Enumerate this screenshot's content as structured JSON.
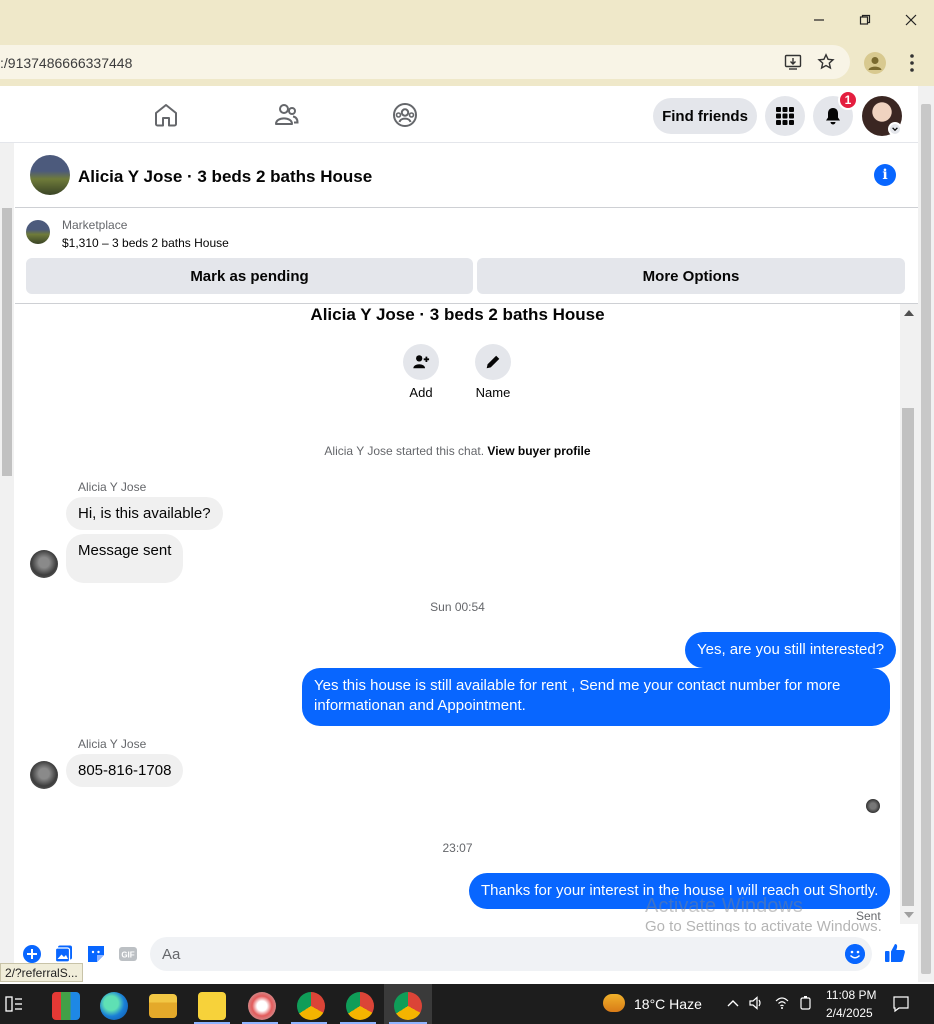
{
  "browser": {
    "url": ":/9137486666337448",
    "status_link": "2/?referralS..."
  },
  "nav": {
    "find_friends": "Find friends",
    "notification_count": "1"
  },
  "chat": {
    "title": "Alicia Y Jose · 3 beds 2 baths House",
    "marketplace_label": "Marketplace",
    "listing": "$1,310 – 3 beds 2 baths House",
    "mark_pending": "Mark as pending",
    "more_options": "More Options",
    "conversation_title": "Alicia Y Jose · 3 beds 2 baths House",
    "actions": [
      {
        "label": "Add",
        "icon": "add-person-icon"
      },
      {
        "label": "Name",
        "icon": "pencil-icon"
      }
    ],
    "system_message": "Alicia Y Jose started this chat.",
    "view_buyer_profile": "View buyer profile"
  },
  "messages": {
    "sender1": "Alicia Y Jose",
    "in1": "Hi, is this available?",
    "in2": "Message sent",
    "time1": "Sun 00:54",
    "out1": "Yes, are you still interested?",
    "out2": "Yes this house is still available for rent , Send me your contact number for more informationan and Appointment.",
    "sender2": "Alicia Y Jose",
    "in3": "805-816-1708",
    "time2": "23:07",
    "out3": "Thanks for your interest in the house I will reach out Shortly.",
    "sent_status": "Sent"
  },
  "composer": {
    "placeholder": "Aa"
  },
  "watermark": {
    "line1": "Activate Windows",
    "line2": "Go to Settings to activate Windows."
  },
  "taskbar": {
    "weather": "18°C  Haze",
    "time": "11:08 PM",
    "date": "2/4/2025"
  },
  "colors": {
    "accent": "#0866ff",
    "titlebar": "#efe8c9",
    "badge": "#e41e3f"
  }
}
